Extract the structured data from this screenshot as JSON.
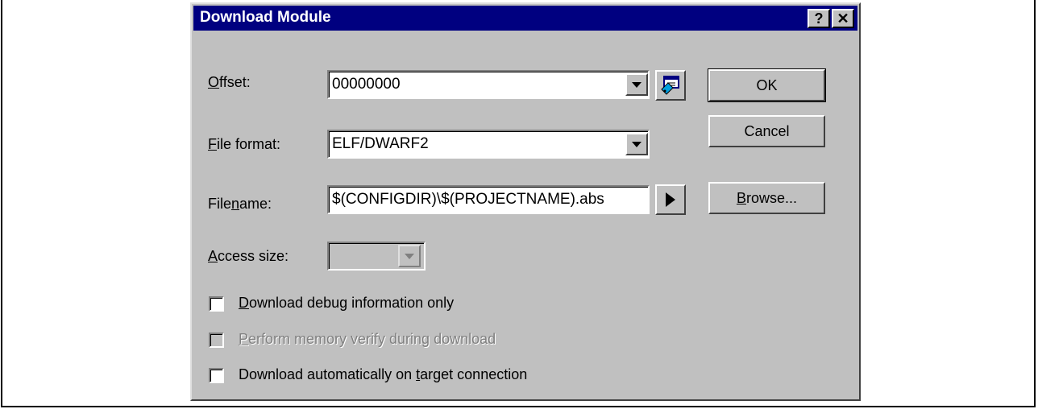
{
  "dialog": {
    "title": "Download Module",
    "help_button": "?",
    "close_button": "✕"
  },
  "offset": {
    "mnemonic": "O",
    "label_rest": "ffset:",
    "value": "00000000"
  },
  "file_format": {
    "mnemonic": "F",
    "label_rest": "ile format:",
    "value": "ELF/DWARF2"
  },
  "filename": {
    "label_pre": "File",
    "mnemonic": "n",
    "label_rest": "ame:",
    "value": "$(CONFIGDIR)\\$(PROJECTNAME).abs"
  },
  "access_size": {
    "mnemonic": "A",
    "label_rest": "ccess size:",
    "value": ""
  },
  "buttons": {
    "ok": "OK",
    "cancel": "Cancel",
    "browse_mnemonic": "B",
    "browse_rest": "rowse..."
  },
  "checkboxes": {
    "debug_only": {
      "mnemonic": "D",
      "rest": "ownload debug information only",
      "checked": false
    },
    "verify": {
      "mnemonic": "P",
      "rest": "erform memory verify during download",
      "checked": false
    },
    "auto": {
      "pre": "Download automatically on ",
      "mnemonic": "t",
      "rest": "arget connection",
      "checked": false
    }
  },
  "icons": [
    "help-icon",
    "close-icon",
    "dropdown-arrow-icon",
    "address-picker-icon",
    "play-arrow-icon"
  ]
}
